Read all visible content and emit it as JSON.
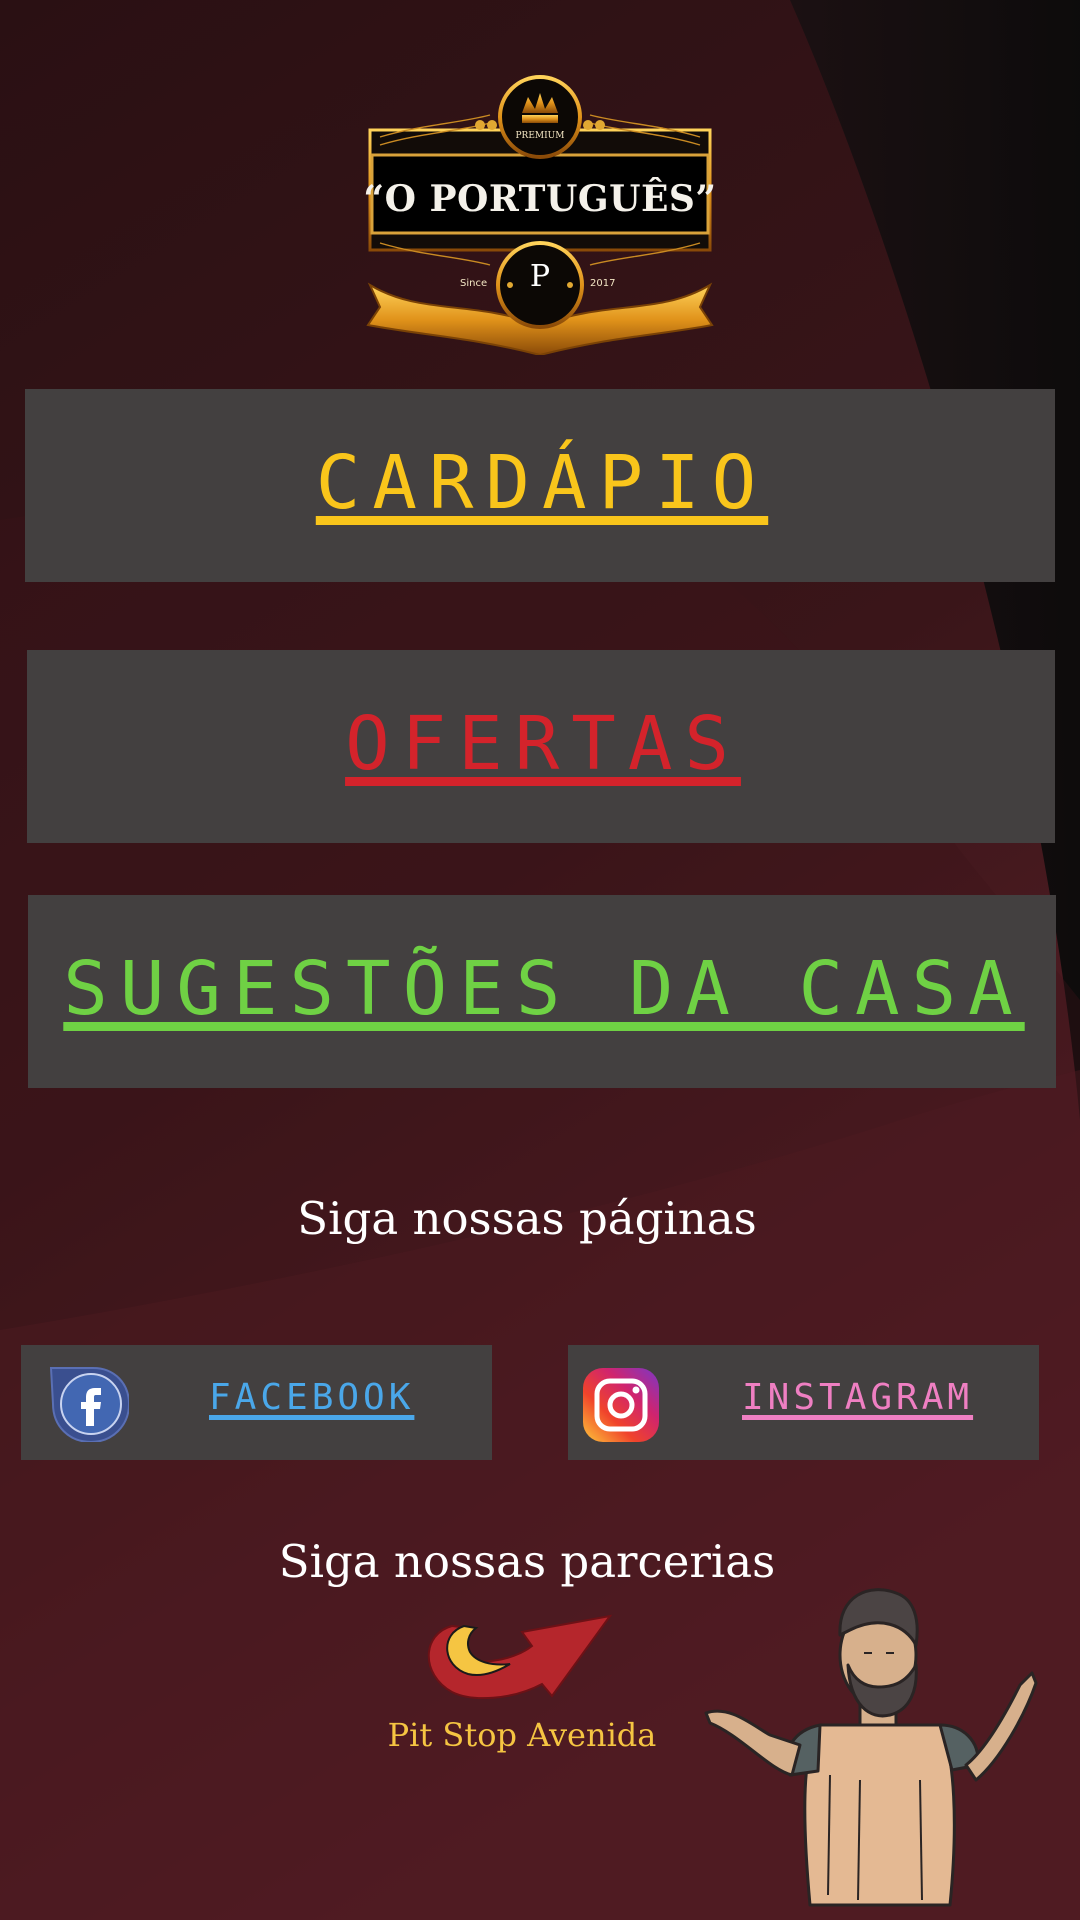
{
  "logo": {
    "title": "“O PORTUGUÊS”",
    "badge": "PREMIUM",
    "since": "Since",
    "year": "2017",
    "monogram": "P"
  },
  "menu": [
    {
      "label": "CARDÁPIO",
      "color": "#f9c51b"
    },
    {
      "label": "OFERTAS",
      "color": "#d4232b"
    },
    {
      "label": "SUGESTÕES DA CASA",
      "color": "#6fd144"
    }
  ],
  "follow_pages": {
    "heading": "Siga nossas páginas"
  },
  "social": {
    "facebook": {
      "label": "FACEBOOK",
      "color": "#4aa7e9",
      "icon": "facebook-icon"
    },
    "instagram": {
      "label": "INSTAGRAM",
      "color": "#ef7fc2",
      "icon": "instagram-icon"
    }
  },
  "follow_partners": {
    "heading": "Siga nossas parcerias"
  },
  "partner": {
    "name": "Pit Stop Avenida",
    "color": "#f5c542"
  },
  "colors": {
    "card_bg": "#434040",
    "bg_dark": "#0c0c0c",
    "bg_wine": "#4a1c22",
    "text": "#ffffff"
  }
}
